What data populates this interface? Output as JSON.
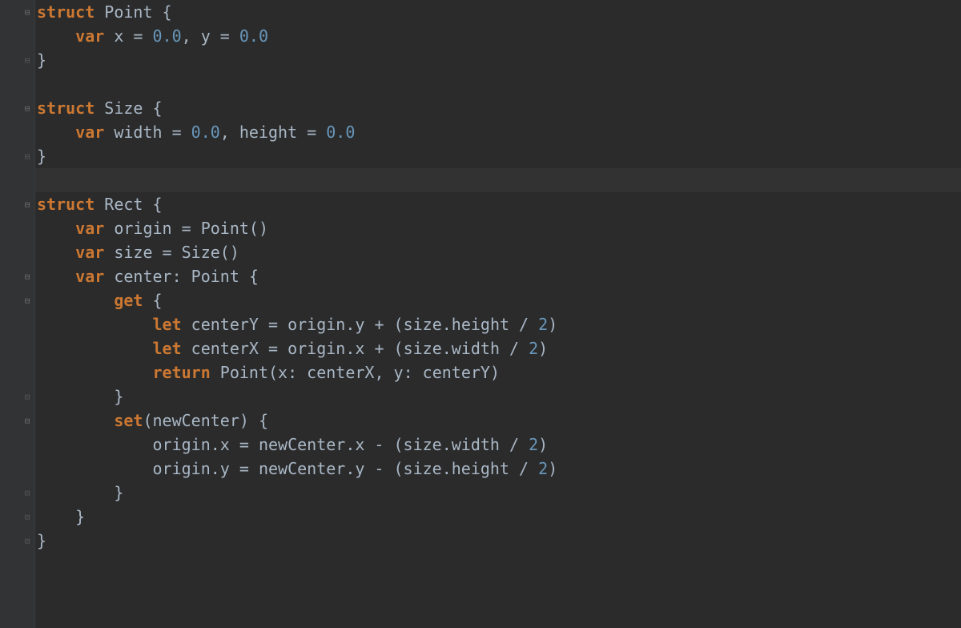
{
  "colors": {
    "keyword": "#cc7832",
    "number": "#6897bb",
    "default": "#a9b7c6",
    "background": "#2b2b2b",
    "gutter": "#313335"
  },
  "cursor_line_index": 7,
  "lines": [
    {
      "fold": "open",
      "tokens": [
        {
          "t": "struct",
          "c": "kw"
        },
        {
          "t": " Point {",
          "c": "type"
        }
      ]
    },
    {
      "fold": "",
      "tokens": [
        {
          "t": "    ",
          "c": ""
        },
        {
          "t": "var",
          "c": "kw"
        },
        {
          "t": " x = ",
          "c": "ident"
        },
        {
          "t": "0.0",
          "c": "num"
        },
        {
          "t": ", y = ",
          "c": "punct"
        },
        {
          "t": "0.0",
          "c": "num"
        }
      ]
    },
    {
      "fold": "close",
      "tokens": [
        {
          "t": "}",
          "c": "brace"
        }
      ]
    },
    {
      "fold": "",
      "tokens": []
    },
    {
      "fold": "open",
      "tokens": [
        {
          "t": "struct",
          "c": "kw"
        },
        {
          "t": " Size {",
          "c": "type"
        }
      ]
    },
    {
      "fold": "",
      "tokens": [
        {
          "t": "    ",
          "c": ""
        },
        {
          "t": "var",
          "c": "kw"
        },
        {
          "t": " width = ",
          "c": "ident"
        },
        {
          "t": "0.0",
          "c": "num"
        },
        {
          "t": ", height = ",
          "c": "punct"
        },
        {
          "t": "0.0",
          "c": "num"
        }
      ]
    },
    {
      "fold": "close",
      "tokens": [
        {
          "t": "}",
          "c": "brace"
        }
      ]
    },
    {
      "fold": "",
      "tokens": []
    },
    {
      "fold": "open",
      "tokens": [
        {
          "t": "struct",
          "c": "kw"
        },
        {
          "t": " Rect {",
          "c": "type"
        }
      ]
    },
    {
      "fold": "",
      "tokens": [
        {
          "t": "    ",
          "c": ""
        },
        {
          "t": "var",
          "c": "kw"
        },
        {
          "t": " origin = Point()",
          "c": "ident"
        }
      ]
    },
    {
      "fold": "",
      "tokens": [
        {
          "t": "    ",
          "c": ""
        },
        {
          "t": "var",
          "c": "kw"
        },
        {
          "t": " size = Size()",
          "c": "ident"
        }
      ]
    },
    {
      "fold": "open",
      "tokens": [
        {
          "t": "    ",
          "c": ""
        },
        {
          "t": "var",
          "c": "kw"
        },
        {
          "t": " center: Point {",
          "c": "ident"
        }
      ]
    },
    {
      "fold": "open",
      "tokens": [
        {
          "t": "        ",
          "c": ""
        },
        {
          "t": "get",
          "c": "kw"
        },
        {
          "t": " {",
          "c": "brace"
        }
      ]
    },
    {
      "fold": "",
      "tokens": [
        {
          "t": "            ",
          "c": ""
        },
        {
          "t": "let",
          "c": "kw"
        },
        {
          "t": " centerY = origin.y + (size.height / ",
          "c": "ident"
        },
        {
          "t": "2",
          "c": "num"
        },
        {
          "t": ")",
          "c": "punct"
        }
      ]
    },
    {
      "fold": "",
      "tokens": [
        {
          "t": "            ",
          "c": ""
        },
        {
          "t": "let",
          "c": "kw"
        },
        {
          "t": " centerX = origin.x + (size.width / ",
          "c": "ident"
        },
        {
          "t": "2",
          "c": "num"
        },
        {
          "t": ")",
          "c": "punct"
        }
      ]
    },
    {
      "fold": "",
      "tokens": [
        {
          "t": "            ",
          "c": ""
        },
        {
          "t": "return",
          "c": "kw"
        },
        {
          "t": " Point(x: centerX, y: centerY)",
          "c": "ident"
        }
      ]
    },
    {
      "fold": "close",
      "tokens": [
        {
          "t": "        }",
          "c": "brace"
        }
      ]
    },
    {
      "fold": "open",
      "tokens": [
        {
          "t": "        ",
          "c": ""
        },
        {
          "t": "set",
          "c": "kw"
        },
        {
          "t": "(newCenter) {",
          "c": "ident"
        }
      ]
    },
    {
      "fold": "",
      "tokens": [
        {
          "t": "            origin.x = newCenter.x - (size.width / ",
          "c": "ident"
        },
        {
          "t": "2",
          "c": "num"
        },
        {
          "t": ")",
          "c": "punct"
        }
      ]
    },
    {
      "fold": "",
      "tokens": [
        {
          "t": "            origin.y = newCenter.y - (size.height / ",
          "c": "ident"
        },
        {
          "t": "2",
          "c": "num"
        },
        {
          "t": ")",
          "c": "punct"
        }
      ]
    },
    {
      "fold": "close",
      "tokens": [
        {
          "t": "        }",
          "c": "brace"
        }
      ]
    },
    {
      "fold": "close",
      "tokens": [
        {
          "t": "    }",
          "c": "brace"
        }
      ]
    },
    {
      "fold": "close",
      "tokens": [
        {
          "t": "}",
          "c": "brace"
        }
      ]
    }
  ]
}
